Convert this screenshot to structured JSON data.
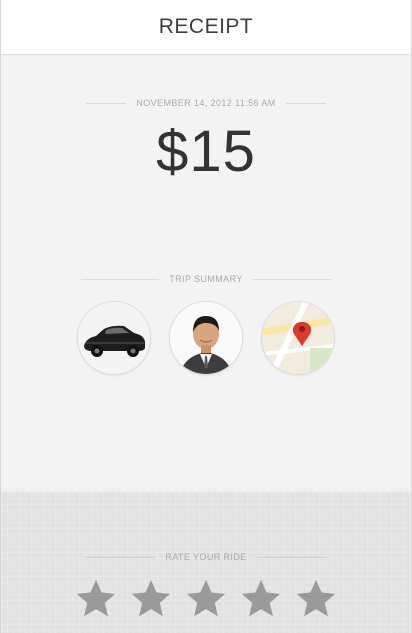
{
  "header": {
    "title": "RECEIPT"
  },
  "receipt": {
    "datetime": "NOVEMBER 14, 2012 11:56 AM",
    "fare": "$15",
    "summary_label": "TRIP SUMMARY"
  },
  "trip_summary": [
    {
      "name": "car-photo"
    },
    {
      "name": "driver-photo"
    },
    {
      "name": "map-thumbnail"
    }
  ],
  "rating": {
    "label": "RATE YOUR RIDE",
    "max_stars": 5,
    "current": 0,
    "star_color": "#9a9a9a"
  },
  "colors": {
    "background": "#efefef",
    "header_bg": "#ffffff",
    "fare_text": "#333333",
    "map_pin": "#d83a2f"
  }
}
